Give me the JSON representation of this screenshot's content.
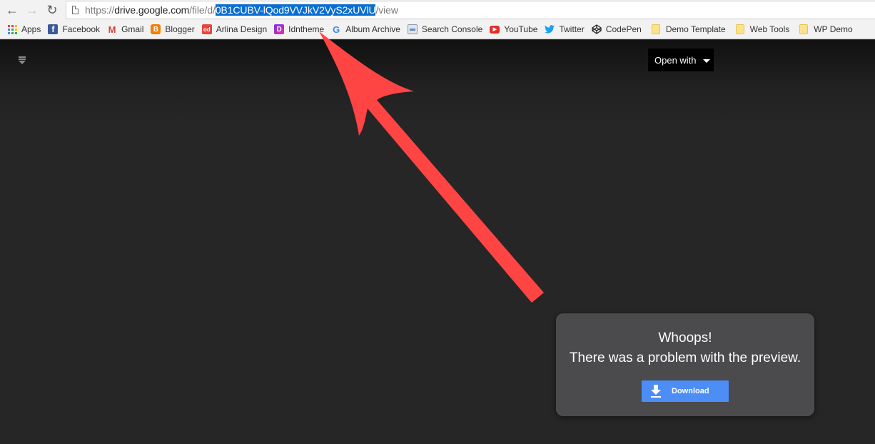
{
  "browser": {
    "nav": {
      "back": "back-arrow",
      "forward": "forward-arrow",
      "reload": "reload"
    },
    "url": {
      "prefix": "https://",
      "host": "drive.google.com",
      "path_before": "/file/d/",
      "selected": "0B1CUBV-lQod9VVJkV2VyS2xUVlU",
      "path_after": "/view"
    },
    "bookmarks": [
      {
        "label": "Apps",
        "icon": "apps-grid-icon"
      },
      {
        "label": "Facebook",
        "icon": "facebook-icon",
        "color": "#3b5998"
      },
      {
        "label": "Gmail",
        "icon": "gmail-icon",
        "color": "#d44638"
      },
      {
        "label": "Blogger",
        "icon": "blogger-icon",
        "color": "#f57d00"
      },
      {
        "label": "Arlina Design",
        "icon": "arlina-icon",
        "color": "#e8453c"
      },
      {
        "label": "Idntheme",
        "icon": "idntheme-icon",
        "color": "#b8359a"
      },
      {
        "label": "Album Archive",
        "icon": "google-icon",
        "color": "#4285f4"
      },
      {
        "label": "Search Console",
        "icon": "search-console-icon",
        "color": "#6b8cc7"
      },
      {
        "label": "YouTube",
        "icon": "youtube-icon",
        "color": "#e52d27"
      },
      {
        "label": "Twitter",
        "icon": "twitter-icon",
        "color": "#1da1f2"
      },
      {
        "label": "CodePen",
        "icon": "codepen-icon",
        "color": "#222222"
      },
      {
        "label": "Demo Template",
        "icon": "folder-icon",
        "color": "#f9d66b"
      },
      {
        "label": "Web Tools",
        "icon": "folder-icon",
        "color": "#f9d66b"
      },
      {
        "label": "WP Demo",
        "icon": "folder-icon",
        "color": "#f9d66b"
      }
    ]
  },
  "viewer": {
    "open_with_label": "Open with",
    "error": {
      "title": "Whoops!",
      "message": "There was a problem with the preview.",
      "download_label": "Download"
    },
    "accent_color": "#4d8ef6",
    "annotation_color": "#ff4444"
  }
}
